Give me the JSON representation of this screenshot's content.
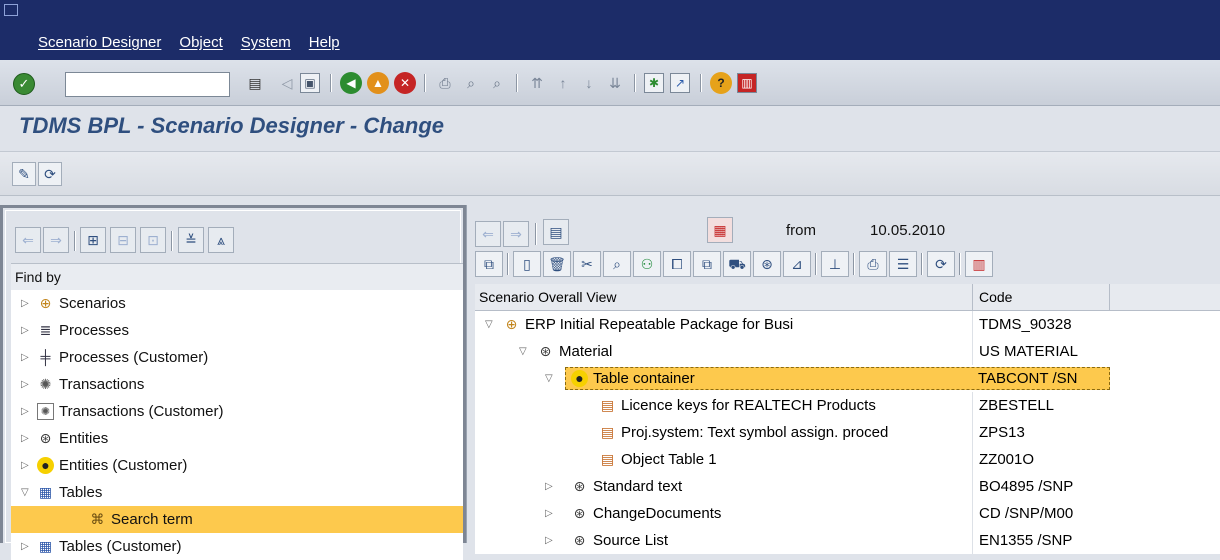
{
  "menubar": {
    "items": [
      "Scenario Designer",
      "Object",
      "System",
      "Help"
    ]
  },
  "toolbar": {
    "command_value": "",
    "icons": [
      "enter-icon",
      "save-icon",
      "back-icon",
      "exit-icon",
      "cancel-icon",
      "print-icon",
      "find-icon",
      "find-next-icon",
      "first-page-icon",
      "previous-page-icon",
      "next-page-icon",
      "last-page-icon",
      "create-session-icon",
      "shortcut-icon",
      "help-icon",
      "layout-icon"
    ]
  },
  "page": {
    "title": "TDMS BPL - Scenario Designer - Change"
  },
  "left_panel": {
    "find_by_label": "Find by",
    "items": [
      {
        "label": "Scenarios",
        "icon": "scenario-icon",
        "expand": "collapsed"
      },
      {
        "label": "Processes",
        "icon": "process-icon",
        "expand": "collapsed"
      },
      {
        "label": "Processes (Customer)",
        "icon": "process-customer-icon",
        "expand": "collapsed"
      },
      {
        "label": "Transactions",
        "icon": "transaction-icon",
        "expand": "collapsed"
      },
      {
        "label": "Transactions (Customer)",
        "icon": "transaction-customer-icon",
        "expand": "collapsed"
      },
      {
        "label": "Entities",
        "icon": "entity-icon",
        "expand": "collapsed"
      },
      {
        "label": "Entities (Customer)",
        "icon": "entity-customer-icon",
        "expand": "collapsed"
      },
      {
        "label": "Tables",
        "icon": "tables-icon",
        "expand": "expanded"
      },
      {
        "label": "Search term",
        "icon": "search-term-icon",
        "expand": "none",
        "selected": true
      },
      {
        "label": "Tables (Customer)",
        "icon": "tables-icon",
        "expand": "collapsed"
      }
    ]
  },
  "right_panel": {
    "from_label": "from",
    "from_date": "10.05.2010",
    "columns": [
      "Scenario Overall View",
      "Code"
    ],
    "rows": [
      {
        "level": 0,
        "expand": "expanded",
        "icon": "scenario-icon",
        "label": "ERP Initial Repeatable Package for Busi",
        "code": "TDMS_90328"
      },
      {
        "level": 1,
        "expand": "expanded",
        "icon": "entity-icon",
        "label": "Material",
        "code": "US MATERIAL"
      },
      {
        "level": 2,
        "expand": "expanded",
        "icon": "entity-customer-icon",
        "label": "Table container",
        "code": "TABCONT /SN",
        "selected": true
      },
      {
        "level": 3,
        "expand": "none",
        "icon": "table-icon",
        "label": "Licence keys for REALTECH Products",
        "code": "ZBESTELL"
      },
      {
        "level": 3,
        "expand": "none",
        "icon": "table-icon",
        "label": "Proj.system: Text symbol assign. proced",
        "code": "ZPS13"
      },
      {
        "level": 3,
        "expand": "none",
        "icon": "table-icon",
        "label": "Object Table 1",
        "code": "ZZ001O"
      },
      {
        "level": 1,
        "expand": "collapsed",
        "icon": "entity-icon",
        "label": "Standard text",
        "code": "BO4895 /SNP"
      },
      {
        "level": 1,
        "expand": "collapsed",
        "icon": "entity-icon",
        "label": "ChangeDocuments",
        "code": "CD /SNP/M00"
      },
      {
        "level": 1,
        "expand": "collapsed",
        "icon": "entity-icon",
        "label": "Source List",
        "code": "EN1355 /SNP"
      }
    ]
  }
}
